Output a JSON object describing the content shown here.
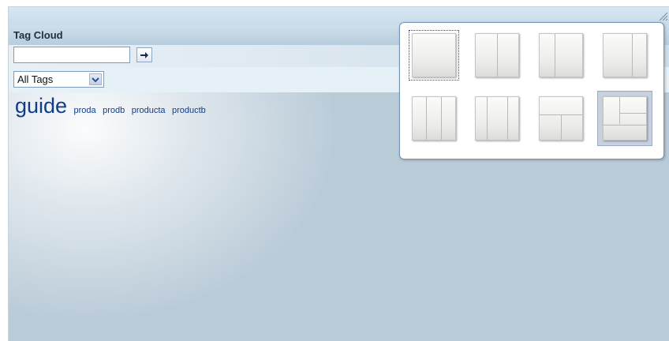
{
  "portlet": {
    "title": "Tag Cloud",
    "search": {
      "value": "",
      "placeholder": ""
    },
    "filter": {
      "selected": "All Tags"
    }
  },
  "tag_cloud": {
    "tags": [
      {
        "label": "guide",
        "size": "large"
      },
      {
        "label": "proda",
        "size": "small"
      },
      {
        "label": "prodb",
        "size": "small"
      },
      {
        "label": "producta",
        "size": "small"
      },
      {
        "label": "productb",
        "size": "small"
      }
    ]
  },
  "layout_picker": {
    "options": [
      {
        "name": "one-column",
        "selected": true,
        "hovered": false
      },
      {
        "name": "two-columns",
        "selected": false,
        "hovered": false
      },
      {
        "name": "two-columns-wide-right",
        "selected": false,
        "hovered": false
      },
      {
        "name": "two-columns-wide-left",
        "selected": false,
        "hovered": false
      },
      {
        "name": "three-columns",
        "selected": false,
        "hovered": false
      },
      {
        "name": "three-columns-wide-center",
        "selected": false,
        "hovered": false
      },
      {
        "name": "top-with-two-columns",
        "selected": false,
        "hovered": false
      },
      {
        "name": "top-columns-with-bottom",
        "selected": false,
        "hovered": true
      }
    ]
  },
  "colors": {
    "background": "#bacbd8",
    "tag_link": "#113c8a",
    "popup_border": "#7393b7"
  }
}
